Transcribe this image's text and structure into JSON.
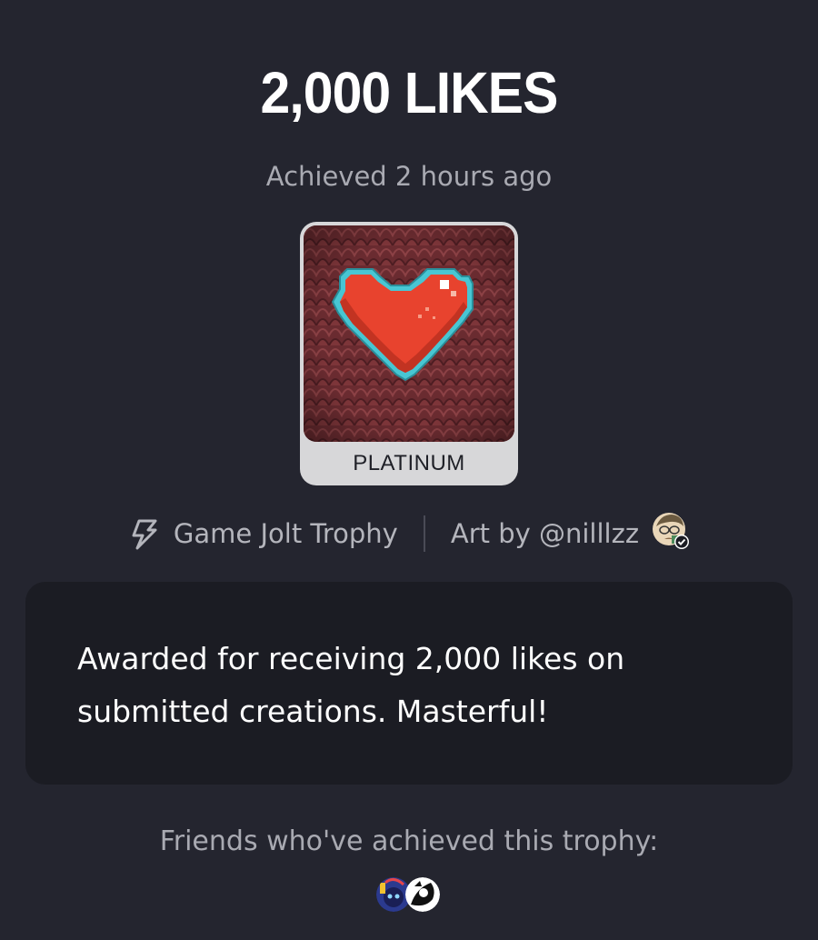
{
  "trophy": {
    "title": "2,000 LIKES",
    "achieved": "Achieved 2 hours ago",
    "tier": "PLATINUM",
    "source": "Game Jolt Trophy",
    "art_credit": "Art by @nilllzz",
    "description": "Awarded for receiving 2,000 likes on submitted creations. Masterful!"
  },
  "friends": {
    "label": "Friends who've achieved this trophy:",
    "count": 2
  },
  "icons": {
    "source_icon": "game-jolt-bolt-icon",
    "verified_icon": "verified-check-icon"
  },
  "colors": {
    "background": "#24252f",
    "card": "#1b1c23",
    "tier_plate": "#d7d7d9",
    "heart": "#e8432e",
    "heart_outline": "#48c6d3"
  }
}
